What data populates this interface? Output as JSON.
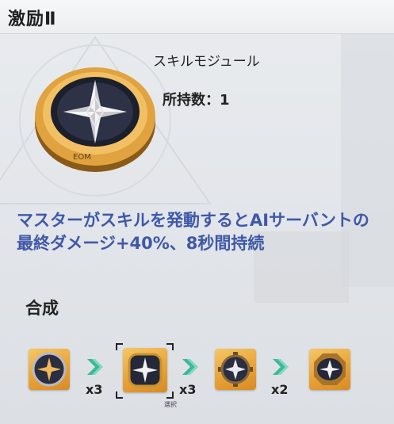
{
  "header": {
    "title": "激励Ⅱ"
  },
  "module": {
    "type_label": "スキルモジュール",
    "owned_text": "所持数：1",
    "description": "マスターがスキルを発動するとAIサーバントの最終ダメージ+40%、8秒間持続",
    "icon": "star-compass-medallion-icon"
  },
  "synthesis": {
    "title": "合成",
    "steps": [
      {
        "icon": "round-compass-module-icon",
        "multiplier": "x3"
      },
      {
        "icon": "square-compass-module-icon",
        "multiplier": "x3",
        "selected": true,
        "selected_label": "選択"
      },
      {
        "icon": "gear-compass-module-icon",
        "multiplier": "x2"
      },
      {
        "icon": "octagon-compass-module-icon"
      }
    ]
  },
  "colors": {
    "description_text": "#3f58a8",
    "tile_gold": "#e8a338",
    "arrow_green": "#3cb89a"
  }
}
